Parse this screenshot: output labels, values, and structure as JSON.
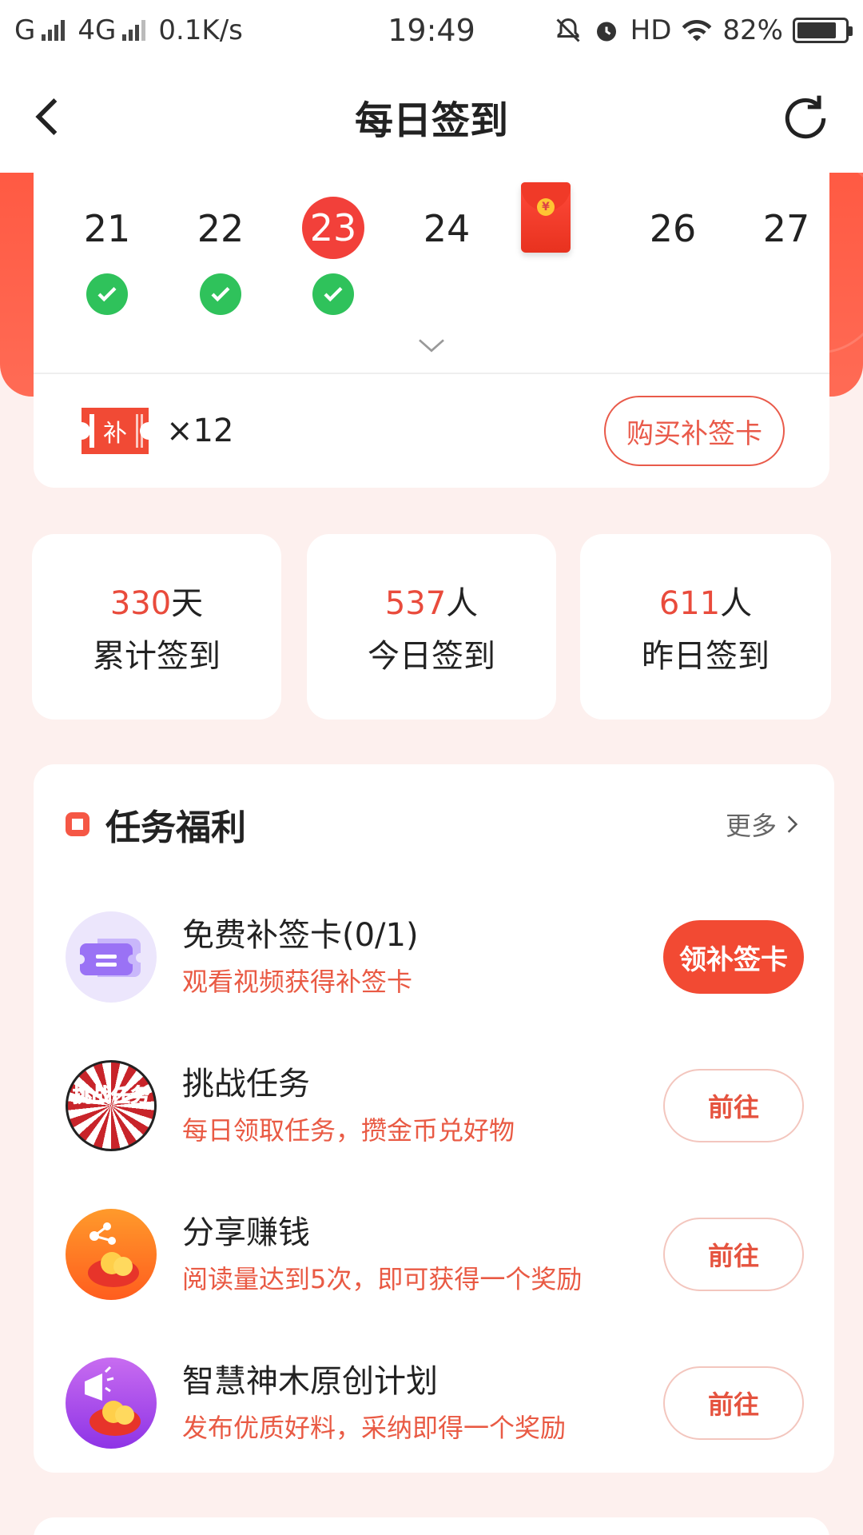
{
  "status_bar": {
    "carrier": "G",
    "network": "4G",
    "speed": "0.1K/s",
    "time": "19:49",
    "hd": "HD",
    "battery": "82%",
    "battery_level": 0.82
  },
  "nav": {
    "title": "每日签到"
  },
  "calendar": {
    "days": [
      {
        "day": "21",
        "checked": true
      },
      {
        "day": "22",
        "checked": true
      },
      {
        "day": "23",
        "checked": true,
        "today": true
      },
      {
        "day": "24",
        "checked": false
      },
      {
        "day": "26",
        "checked": false
      },
      {
        "day": "27",
        "checked": false
      }
    ],
    "redpacket_symbol": "¥"
  },
  "makeup_card": {
    "icon_text": "补",
    "count": "×12",
    "buy_label": "购买补签卡"
  },
  "stats": [
    {
      "value": "330",
      "unit": "天",
      "label": "累计签到"
    },
    {
      "value": "537",
      "unit": "人",
      "label": "今日签到"
    },
    {
      "value": "611",
      "unit": "人",
      "label": "昨日签到"
    }
  ],
  "tasks": {
    "title": "任务福利",
    "more": "更多",
    "items": [
      {
        "title": "免费补签卡(0/1)",
        "desc": "观看视频获得补签卡",
        "button": "领补签卡",
        "icon": "ticket-icon"
      },
      {
        "title": "挑战任务",
        "desc": "每日领取任务，攒金币兑好物",
        "button": "前往",
        "icon": "challenge-icon",
        "icon_text": "挑战任务"
      },
      {
        "title": "分享赚钱",
        "desc": "阅读量达到5次，即可获得一个奖励",
        "button": "前往",
        "icon": "share-icon"
      },
      {
        "title": "智慧神木原创计划",
        "desc": "发布优质好料，采纳即得一个奖励",
        "button": "前往",
        "icon": "megaphone-icon"
      }
    ]
  }
}
